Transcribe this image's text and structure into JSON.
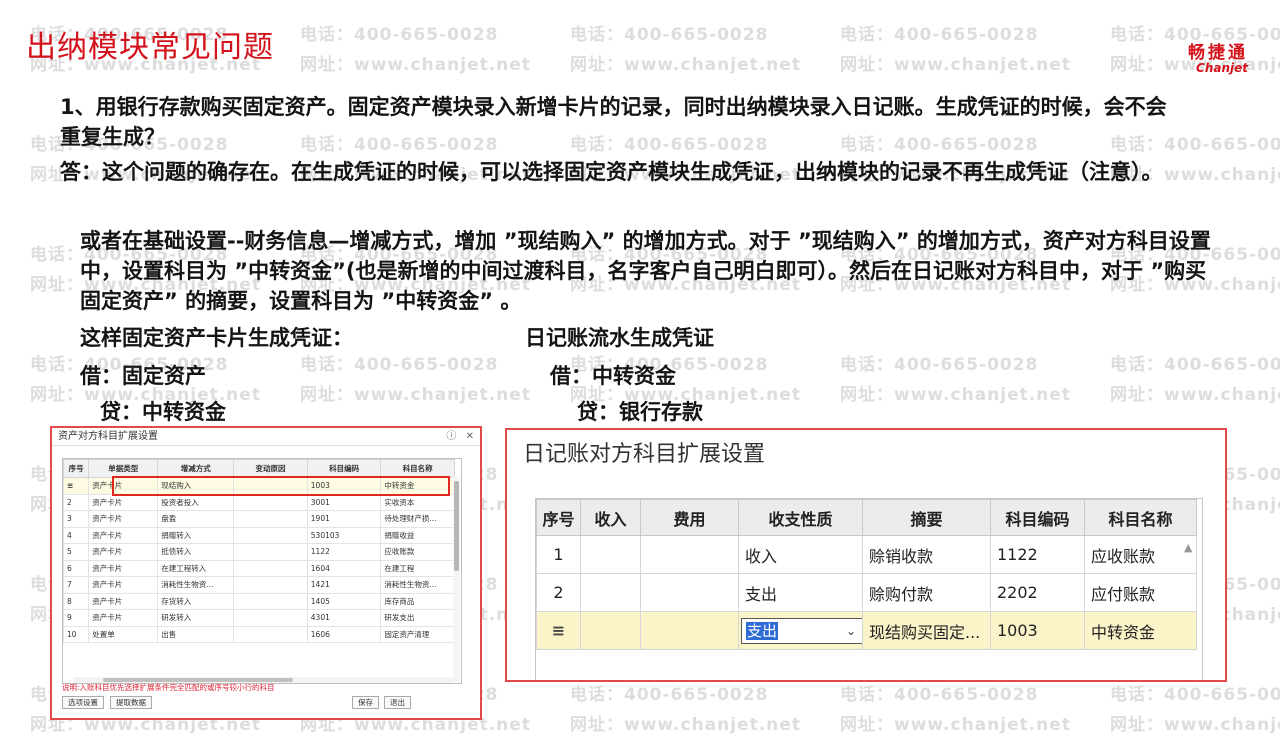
{
  "header": {
    "title": "出纳模块常见问题",
    "brand_cn": "畅捷通",
    "brand_en": "Chanjet"
  },
  "watermark": {
    "phone": "电话：400-665-0028",
    "site": "网址：www.chanjet.net"
  },
  "body": {
    "question": "1、用银行存款购买固定资产。固定资产模块录入新增卡片的记录，同时出纳模块录入日记账。生成凭证的时候，会不会重复生成？",
    "answer": "答：这个问题的确存在。在生成凭证的时候，可以选择固定资产模块生成凭证，出纳模块的记录不再生成凭证（注意）。",
    "alt_method": "或者在基础设置--财务信息—增减方式，增加 ”现结购入” 的增加方式。对于 ”现结购入” 的增加方式，资产对方科目设置中，设置科目为 ”中转资金”(也是新增的中间过渡科目，名字客户自己明白即可）。然后在日记账对方科目中，对于 ”购买固定资产” 的摘要，设置科目为 ”中转资金” 。",
    "left_caption": "这样固定资产卡片生成凭证：",
    "left_debit": "借：固定资产",
    "left_credit": "贷：中转资金",
    "right_caption": "日记账流水生成凭证",
    "right_debit": "借：中转资金",
    "right_credit": "贷：银行存款"
  },
  "left_dialog": {
    "title": "资产对方科目扩展设置",
    "help_icon": "question-icon",
    "close_icon": "close-icon",
    "columns": [
      "序号",
      "单据类型",
      "增减方式",
      "变动原因",
      "科目编码",
      "科目名称"
    ],
    "rows": [
      [
        "",
        "资产卡片",
        "现结购入",
        "",
        "1003",
        "中转资金"
      ],
      [
        "2",
        "资产卡片",
        "投资者投入",
        "",
        "3001",
        "实收资本"
      ],
      [
        "3",
        "资产卡片",
        "盘盈",
        "",
        "1901",
        "待处理财产损..."
      ],
      [
        "4",
        "资产卡片",
        "捐赠转入",
        "",
        "530103",
        "捐赠收益"
      ],
      [
        "5",
        "资产卡片",
        "抵债转入",
        "",
        "1122",
        "应收账款"
      ],
      [
        "6",
        "资产卡片",
        "在建工程转入",
        "",
        "1604",
        "在建工程"
      ],
      [
        "7",
        "资产卡片",
        "消耗性生物资...",
        "",
        "1421",
        "消耗性生物资..."
      ],
      [
        "8",
        "资产卡片",
        "存货转入",
        "",
        "1405",
        "库存商品"
      ],
      [
        "9",
        "资产卡片",
        "研发转入",
        "",
        "4301",
        "研发支出"
      ],
      [
        "10",
        "处置单",
        "出售",
        "",
        "1606",
        "固定资产清理"
      ]
    ],
    "note": "说明:入账科目优先选择扩展条件完全匹配的或序号较小行的科目",
    "btn_options": "选项设置",
    "btn_fetch": "提取数据",
    "btn_save": "保存",
    "btn_exit": "退出"
  },
  "right_dialog": {
    "title": "日记账对方科目扩展设置",
    "columns": [
      "序号",
      "收入",
      "费用",
      "收支性质",
      "摘要",
      "科目编码",
      "科目名称"
    ],
    "rows": [
      [
        "1",
        "",
        "",
        "收入",
        "赊销收款",
        "1122",
        "应收账款"
      ],
      [
        "2",
        "",
        "",
        "支出",
        "赊购付款",
        "2202",
        "应付账款"
      ],
      [
        "",
        "",
        "",
        "支出",
        "现结购买固定...",
        "1003",
        "中转资金"
      ]
    ],
    "row_icon": "insert-row-icon"
  }
}
